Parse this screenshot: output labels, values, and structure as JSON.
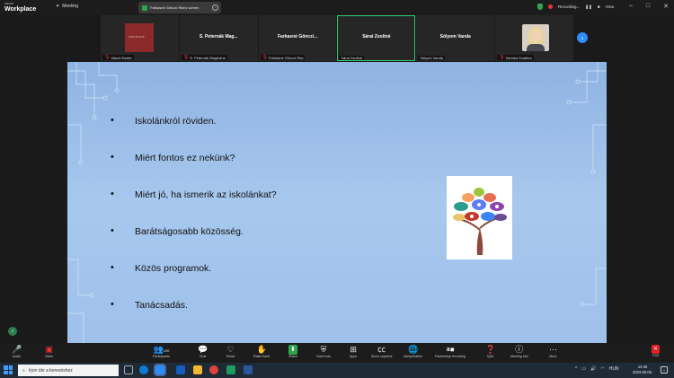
{
  "titlebar": {
    "brand_small": "zoom",
    "brand_big": "Workplace",
    "meeting_label": "Meeting",
    "share_pill_text": "Farkasné Gönczi Rita's screen",
    "recording_label": "Recording...",
    "view_label": "View"
  },
  "gallery": {
    "tiles": [
      {
        "name": "",
        "label": "Varsói Eszter",
        "has_book": true,
        "book_text": "VITE ALTIUS"
      },
      {
        "name": "S. Peternák Mag...",
        "label": "S. Peternák Magdolna"
      },
      {
        "name": "Farkasné Gönczi...",
        "label": "Farkasné Gönczi Rita"
      },
      {
        "name": "Sárai Zsoltné",
        "label": "Sárai Zsoltné",
        "active": true
      },
      {
        "name": "Sólyom Vanda",
        "label": "Sólyom Vanda"
      },
      {
        "name": "",
        "label": "Várinka Szabina",
        "has_face": true
      }
    ]
  },
  "slide": {
    "bullets": [
      "Iskolánkról röviden.",
      "Miért fontos ez nekünk?",
      "Miért jó, ha ismerik az iskolánkat?",
      "Barátságosabb közösség.",
      "Közös programok.",
      "Tanácsadás."
    ]
  },
  "toolbar": {
    "audio": "Audio",
    "video": "Video",
    "participants": "Participants",
    "participants_count": "120",
    "chat": "Chat",
    "react": "React",
    "raise_hand": "Raise hand",
    "share": "Share",
    "host_tools": "Host tools",
    "apps": "Apps",
    "captions": "Show captions",
    "interpretation": "Interpretation",
    "recording": "Pause/stop recording",
    "qa": "Q&A",
    "info": "Meeting info",
    "more": "More",
    "end": "End"
  },
  "taskbar": {
    "search_placeholder": "Írjon ide a kereséshez",
    "lang": "HUN",
    "time": "12:45",
    "date": "2023.06.06."
  },
  "colors": {
    "accent_blue": "#2d8cff",
    "active_green": "#2ecc71",
    "end_red": "#dd2222"
  }
}
